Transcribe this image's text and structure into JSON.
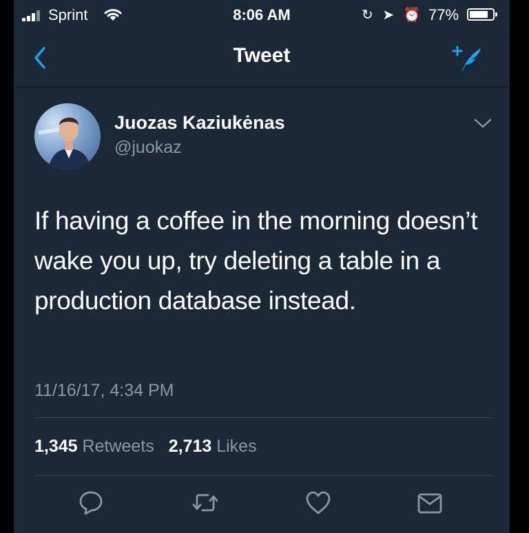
{
  "status_bar": {
    "carrier": "Sprint",
    "time": "8:06 AM",
    "battery": "77%",
    "icons": [
      "signal-icon",
      "wifi-icon",
      "lock-rotation-icon",
      "location-icon",
      "alarm-icon",
      "battery-icon"
    ]
  },
  "nav": {
    "title": "Tweet",
    "icons": [
      "back-chevron-icon",
      "compose-tweet-icon"
    ]
  },
  "tweet": {
    "author_name": "Juozas Kaziukėnas",
    "author_handle": "@juokaz",
    "text": "If having a coffee in the morning doesn’t wake you up, try deleting a table in a production database instead.",
    "timestamp": "11/16/17, 4:34 PM"
  },
  "stats": {
    "retweets_count": "1,345",
    "retweets_label": "Retweets",
    "likes_count": "2,713",
    "likes_label": "Likes"
  },
  "actions": [
    "reply-icon",
    "retweet-icon",
    "like-icon",
    "share-icon"
  ],
  "colors": {
    "background": "#1b2836",
    "secondary_text": "#8899a6",
    "accent": "#1da1f2",
    "divider": "#38444d"
  }
}
